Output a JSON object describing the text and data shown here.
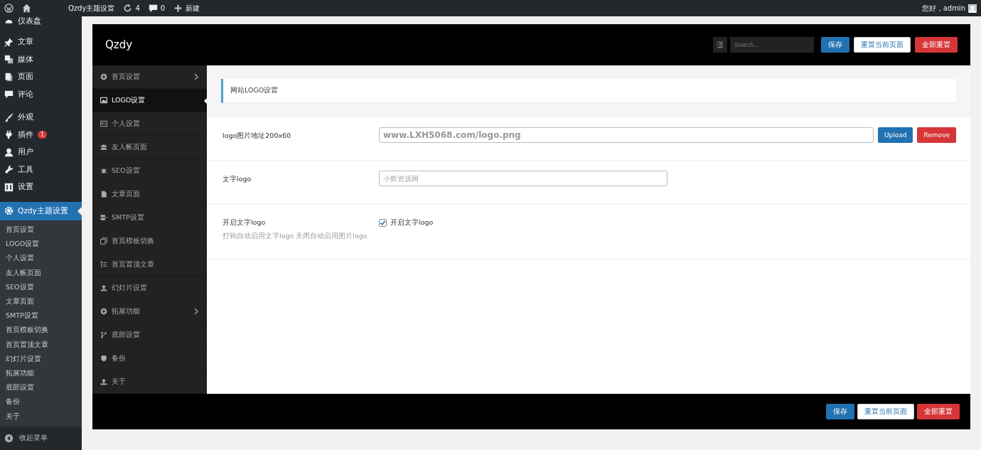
{
  "admin_bar": {
    "site_title": "Qzdy主题设置",
    "updates": "4",
    "comments": "0",
    "new": "新建",
    "greeting": "您好，admin"
  },
  "wp_menu": {
    "items": [
      {
        "label": "仪表盘",
        "selected": false
      },
      {
        "label": "文章",
        "selected": false
      },
      {
        "label": "媒体",
        "selected": false
      },
      {
        "label": "页面",
        "selected": false
      },
      {
        "label": "评论",
        "selected": false
      },
      {
        "label": "外观",
        "selected": false
      },
      {
        "label": "插件",
        "selected": false,
        "badge": "1"
      },
      {
        "label": "用户",
        "selected": false
      },
      {
        "label": "工具",
        "selected": false
      },
      {
        "label": "设置",
        "selected": false
      },
      {
        "label": "Qzdy主题设置",
        "selected": true
      }
    ],
    "submenu": [
      "首页设置",
      "LOGO设置",
      "个人设置",
      "友人帐页面",
      "SEO设置",
      "文章页面",
      "SMTP设置",
      "首页模板切换",
      "首页置顶文章",
      "幻灯片设置",
      "拓展功能",
      "底部设置",
      "备份",
      "关于"
    ],
    "collapse": "收起菜单"
  },
  "panel": {
    "title": "Qzdy",
    "search": {
      "placeholder": "Search..."
    },
    "buttons": [
      {
        "label": "保存",
        "kind": "primary"
      },
      {
        "label": "重置当前页面",
        "kind": "default"
      },
      {
        "label": "全部重置",
        "kind": "danger"
      }
    ],
    "nav": [
      {
        "label": "首页设置",
        "selected": false,
        "has_children": true
      },
      {
        "label": "LOGO设置",
        "selected": true,
        "has_children": false
      },
      {
        "label": "个人设置",
        "selected": false,
        "has_children": false
      },
      {
        "label": "友人帐页面",
        "selected": false,
        "has_children": false
      },
      {
        "label": "SEO设置",
        "selected": false,
        "has_children": false
      },
      {
        "label": "文章页面",
        "selected": false,
        "has_children": false
      },
      {
        "label": "SMTP设置",
        "selected": false,
        "has_children": false
      },
      {
        "label": "首页模板切换",
        "selected": false,
        "has_children": false
      },
      {
        "label": "首页置顶文章",
        "selected": false,
        "has_children": false
      },
      {
        "label": "幻灯片设置",
        "selected": false,
        "has_children": false
      },
      {
        "label": "拓展功能",
        "selected": false,
        "has_children": true
      },
      {
        "label": "底部设置",
        "selected": false,
        "has_children": false
      },
      {
        "label": "备份",
        "selected": false,
        "has_children": false
      },
      {
        "label": "关于",
        "selected": false,
        "has_children": false
      }
    ],
    "section_title": "网站LOGO设置",
    "fields": [
      {
        "kind": "upload",
        "label": "logo图片地址200x60",
        "value": "www.LXH5068.com/logo.png",
        "buttons": [
          {
            "label": "Upload",
            "kind": "primary"
          },
          {
            "label": "Remove",
            "kind": "danger"
          }
        ]
      },
      {
        "kind": "text",
        "label": "文字logo",
        "placeholder": "小辉资源网"
      },
      {
        "kind": "checkbox",
        "label": "开启文字logo",
        "description": "打钩自动启用文字logo 关闭自动启用图片logo",
        "checked": true,
        "checkbox_label": "开启文字logo"
      }
    ],
    "footer_buttons": [
      {
        "label": "保存",
        "kind": "primary"
      },
      {
        "label": "重置当前页面",
        "kind": "default"
      },
      {
        "label": "全部重置",
        "kind": "danger"
      }
    ]
  }
}
